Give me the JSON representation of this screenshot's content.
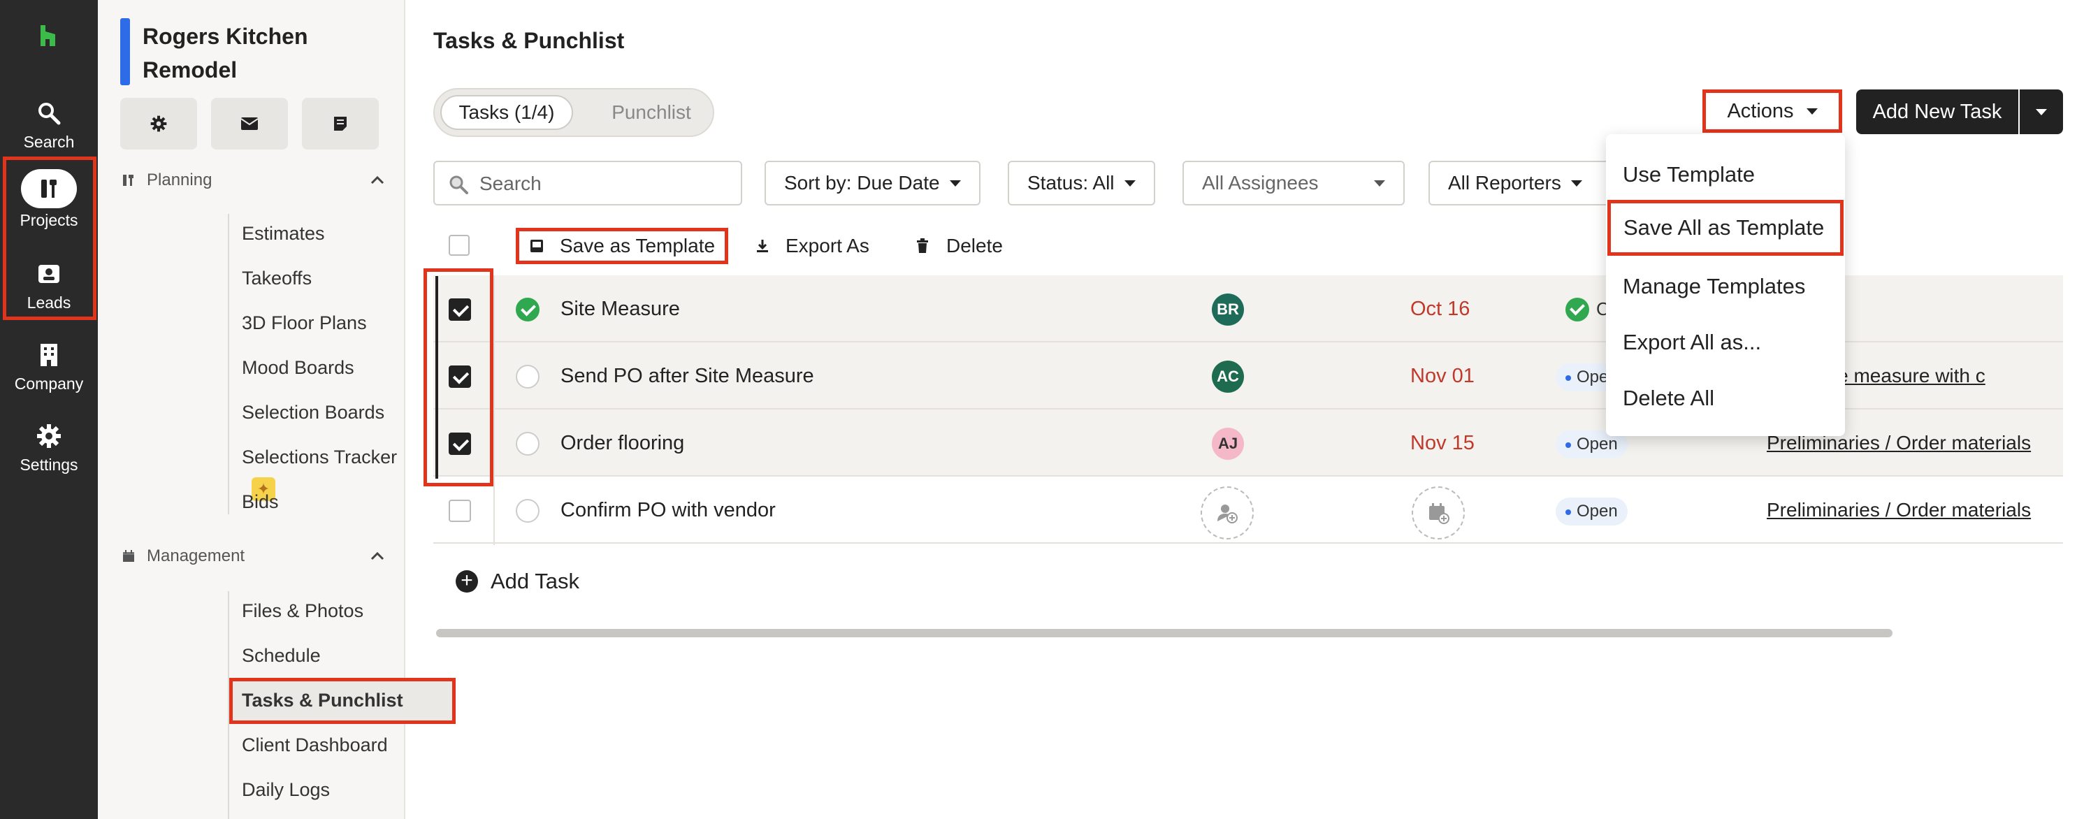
{
  "rail": {
    "items": [
      {
        "label": "Search"
      },
      {
        "label": "Projects"
      },
      {
        "label": "Leads"
      },
      {
        "label": "Company"
      },
      {
        "label": "Settings"
      }
    ]
  },
  "sidebar": {
    "project_title": "Rogers Kitchen Remodel",
    "sections": {
      "planning": {
        "label": "Planning",
        "items": [
          "Estimates",
          "Takeoffs",
          "3D Floor Plans",
          "Mood Boards",
          "Selection Boards",
          "Selections Tracker",
          "Bids"
        ]
      },
      "management": {
        "label": "Management",
        "items": [
          "Files & Photos",
          "Schedule",
          "Tasks & Punchlist",
          "Client Dashboard",
          "Daily Logs"
        ]
      }
    }
  },
  "main": {
    "title": "Tasks & Punchlist",
    "tabs": [
      {
        "label": "Tasks (1/4)"
      },
      {
        "label": "Punchlist"
      }
    ],
    "actions_label": "Actions",
    "add_task_label": "Add New Task",
    "search": {
      "placeholder": "Search"
    },
    "filters": {
      "sort": "Sort by: Due Date",
      "status": "Status: All",
      "assignees": "All Assignees",
      "reporters": "All Reporters"
    },
    "bulk": {
      "save_template": "Save as Template",
      "export": "Export As",
      "delete": "Delete"
    },
    "rows": [
      {
        "name": "Site Measure",
        "assignee": "BR",
        "due": "Oct 16",
        "status": "C",
        "link": ""
      },
      {
        "name": "Send PO after Site Measure",
        "assignee": "AC",
        "due": "Nov 01",
        "status": "Ope",
        "link": "ries / Site measure with c"
      },
      {
        "name": "Order flooring",
        "assignee": "AJ",
        "due": "Nov 15",
        "status": "Open",
        "link": "Preliminaries / Order materials"
      },
      {
        "name": "Confirm PO with vendor",
        "assignee": "",
        "due": "",
        "status": "Open",
        "link": "Preliminaries / Order materials"
      }
    ],
    "add_row_label": "Add Task"
  },
  "menu": {
    "items": [
      "Use Template",
      "Save All as Template",
      "Manage Templates",
      "Export All as...",
      "Delete All"
    ]
  },
  "colors": {
    "highlight": "#e0341d",
    "rail_bg": "#2a2a2a",
    "brand_green": "#3dbb4a",
    "project_accent": "#2e6be6",
    "due_red": "#c0392b",
    "avatar_br": "#1e6b5a",
    "avatar_ac": "#1f6b4f",
    "avatar_aj": "#f4b8c8"
  }
}
